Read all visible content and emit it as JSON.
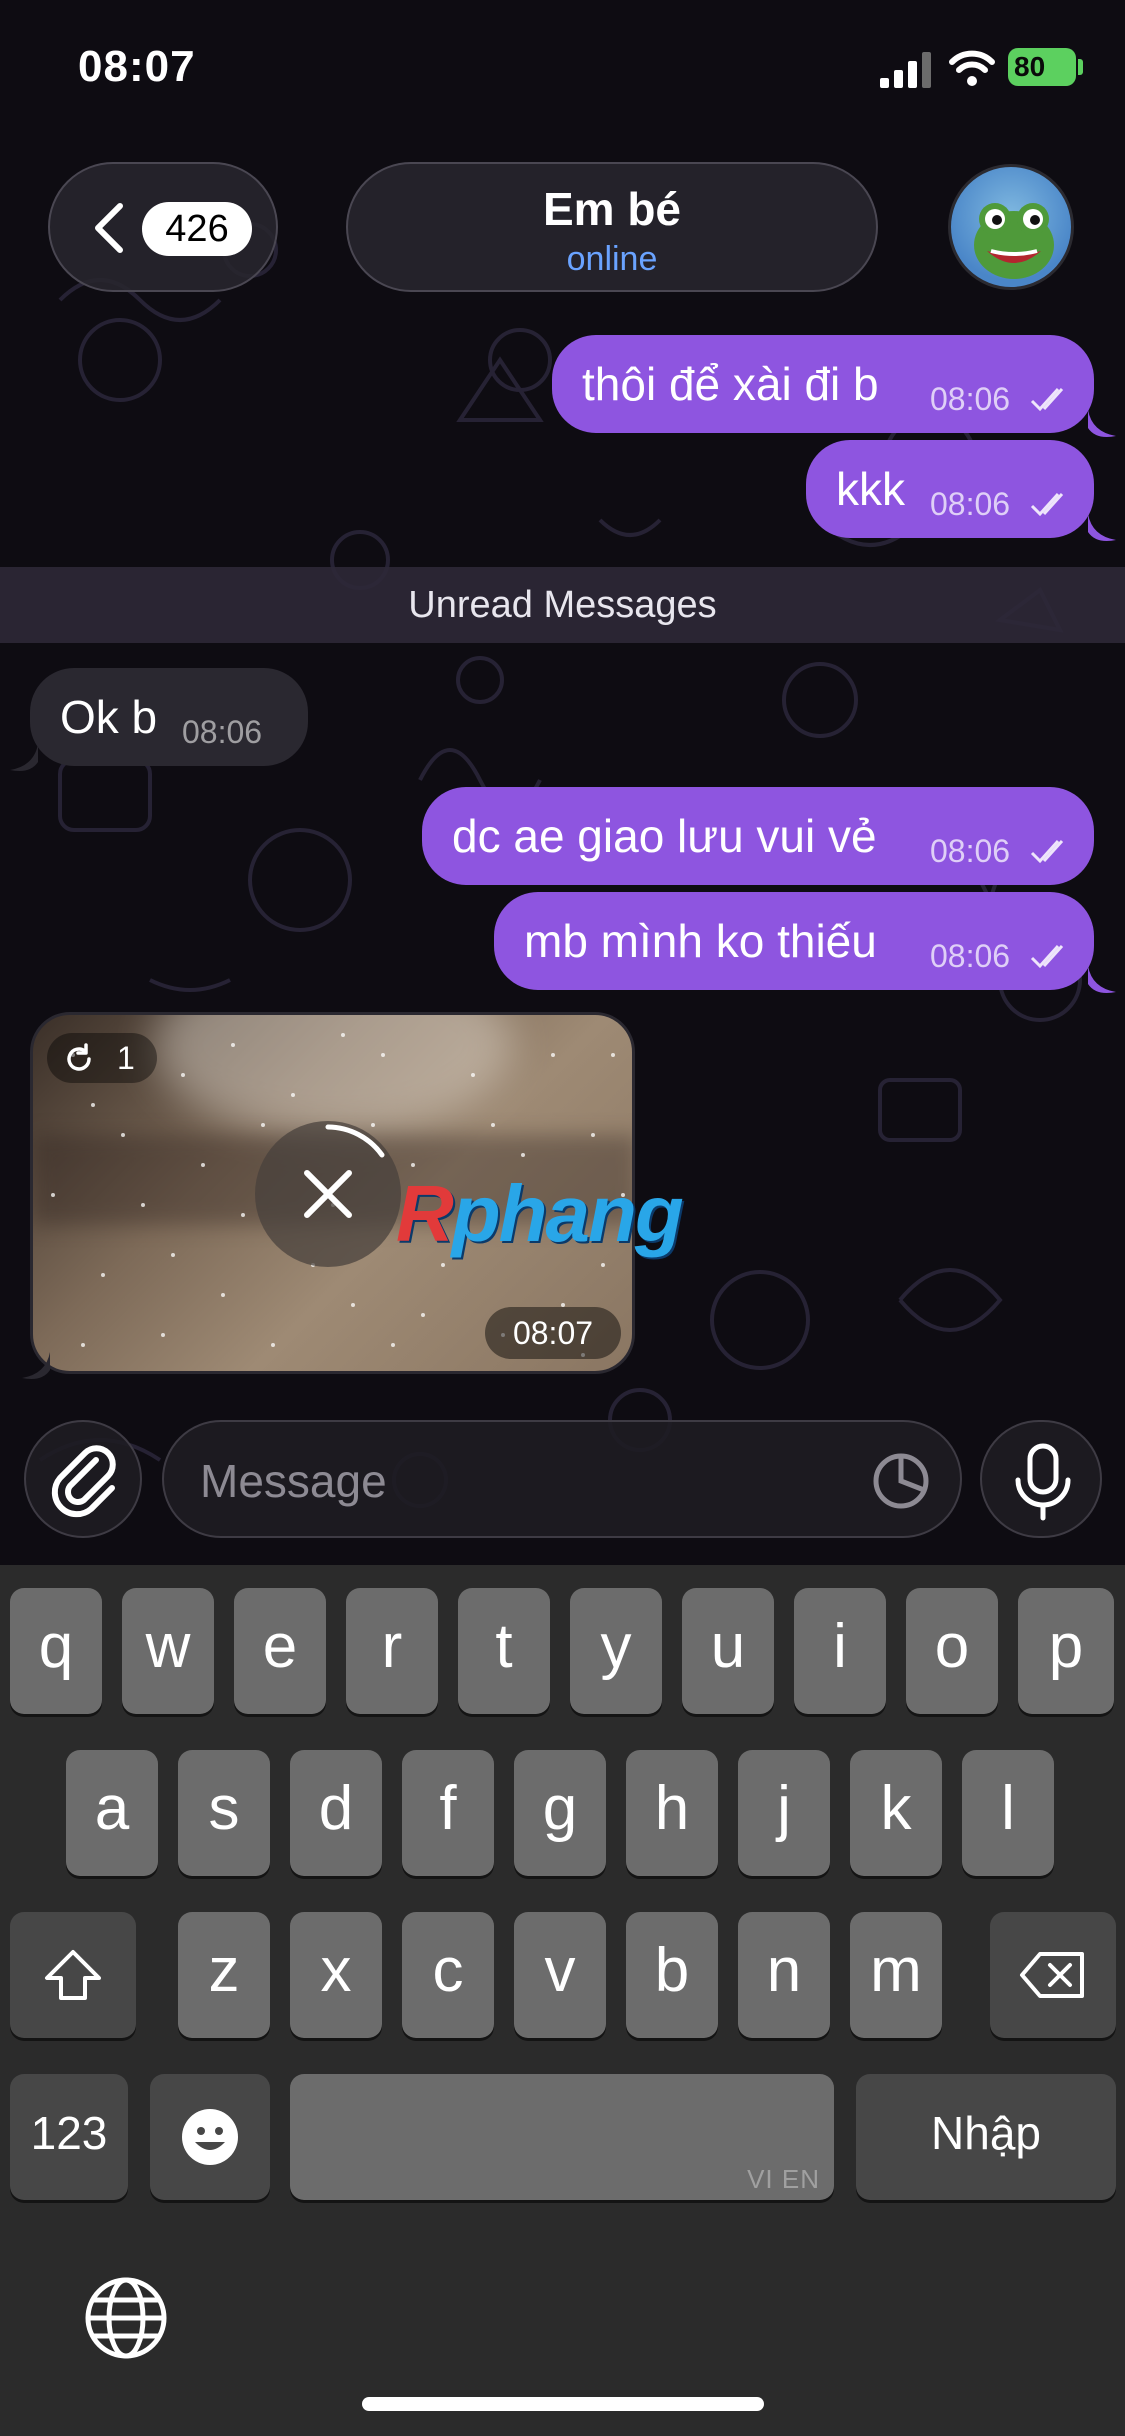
{
  "status_bar": {
    "time": "08:07",
    "battery": "80"
  },
  "header": {
    "back_count": "426",
    "chat_name": "Em bé",
    "chat_status": "online"
  },
  "messages": [
    {
      "dir": "out",
      "text": "thôi để xài đi b",
      "time": "08:06"
    },
    {
      "dir": "out",
      "text": "kkk",
      "time": "08:06"
    },
    {
      "dir": "in",
      "text": "Ok b",
      "time": "08:06"
    },
    {
      "dir": "out",
      "text": "dc ae giao lưu vui vẻ",
      "time": "08:06"
    },
    {
      "dir": "out",
      "text": "mb mình ko thiếu",
      "time": "08:06"
    }
  ],
  "unread_label": "Unread Messages",
  "media": {
    "view_count": "1",
    "time": "08:07"
  },
  "watermark": {
    "r": "R",
    "rest": "phang"
  },
  "input": {
    "placeholder": "Message"
  },
  "keyboard": {
    "row1": [
      "q",
      "w",
      "e",
      "r",
      "t",
      "y",
      "u",
      "i",
      "o",
      "p"
    ],
    "row2": [
      "a",
      "s",
      "d",
      "f",
      "g",
      "h",
      "j",
      "k",
      "l"
    ],
    "row3": [
      "z",
      "x",
      "c",
      "v",
      "b",
      "n",
      "m"
    ],
    "numbers_label": "123",
    "space_lang": "VI EN",
    "return_label": "Nhập"
  },
  "colors": {
    "outgoing_bubble": "#8e55e0",
    "incoming_bubble": "#2a2830",
    "online": "#6aa3ff"
  }
}
